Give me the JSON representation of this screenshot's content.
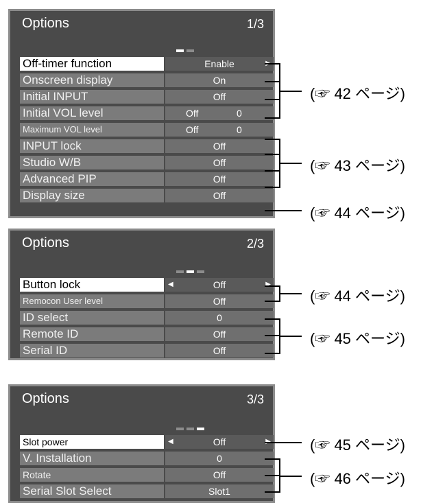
{
  "panels": [
    {
      "title": "Options",
      "page": "1/3",
      "rows": [
        {
          "label": "Off-timer function",
          "value": "Enable"
        },
        {
          "label": "Onscreen display",
          "value": "On"
        },
        {
          "label": "Initial INPUT",
          "value": "Off"
        },
        {
          "label": "Initial VOL level",
          "value": "Off",
          "num": "0"
        },
        {
          "label": "Maximum VOL level",
          "value": "Off",
          "num": "0"
        },
        {
          "label": "INPUT lock",
          "value": "Off"
        },
        {
          "label": "Studio W/B",
          "value": "Off"
        },
        {
          "label": "Advanced PIP",
          "value": "Off"
        },
        {
          "label": "Display size",
          "value": "Off"
        }
      ]
    },
    {
      "title": "Options",
      "page": "2/3",
      "rows": [
        {
          "label": "Button lock",
          "value": "Off"
        },
        {
          "label": "Remocon User level",
          "value": "Off"
        },
        {
          "label": "ID select",
          "value": "0"
        },
        {
          "label": "Remote ID",
          "value": "Off"
        },
        {
          "label": "Serial ID",
          "value": "Off"
        }
      ]
    },
    {
      "title": "Options",
      "page": "3/3",
      "rows": [
        {
          "label": "Slot power",
          "value": "Off"
        },
        {
          "label": "V. Installation",
          "value": "0"
        },
        {
          "label": "Rotate",
          "value": "Off"
        },
        {
          "label": "Serial Slot Select",
          "value": "Slot1"
        }
      ]
    }
  ],
  "references": [
    "(☞ 42 ページ)",
    "(☞ 43 ページ)",
    "(☞ 44 ページ)",
    "(☞ 44 ページ)",
    "(☞ 45 ページ)",
    "(☞ 45 ページ)",
    "(☞ 46 ページ)"
  ],
  "icons": {
    "left_arrow": "triangle-left-icon",
    "right_arrow": "triangle-right-icon",
    "reference": "pointing-hand-icon"
  },
  "colors": {
    "panel_bg": "#4a4a4a",
    "panel_border": "#8c8c8c",
    "label_bg": "#7b7b7b",
    "value_bg": "#6f6f6f",
    "selected_bg": "#ffffff"
  }
}
